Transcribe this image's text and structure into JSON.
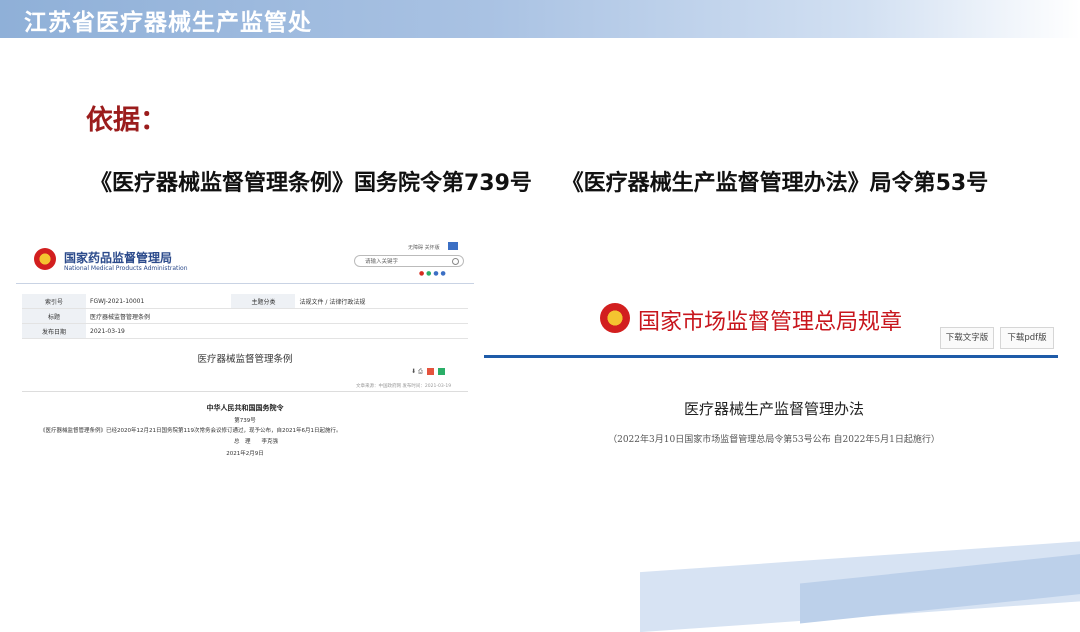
{
  "header": {
    "title": "江苏省医疗器械生产监管处"
  },
  "basis_label": "依据：",
  "regulations": [
    "《医疗器械监督管理条例》国务院令第739号",
    "《医疗器械生产监督管理办法》局令第53号"
  ],
  "nmpa": {
    "name_cn": "国家药品监督管理局",
    "name_en": "National Medical Products Administration",
    "top_links": "无障碍  关怀版",
    "search_placeholder": "请输入关键字",
    "meta": {
      "index_label": "索引号",
      "index_value": "FGWJ-2021-10001",
      "topic_label": "主题分类",
      "topic_value": "法规文件 / 法律行政法规",
      "title_label": "标题",
      "title_value": "医疗器械监督管理条例",
      "date_label": "发布日期",
      "date_value": "2021-03-19"
    },
    "doc_title": "医疗器械监督管理条例",
    "date_line": "文章来源：中国政府网 发布时间：2021-03-19",
    "issuer": "中华人民共和国国务院令",
    "order_no": "第739号",
    "promulgation": "《医疗器械监督管理条例》已经2020年12月21日国务院第119次常务会议修订通过，现予公布，自2021年6月1日起施行。",
    "premier": "总　理　　李克强",
    "sign_date": "2021年2月9日"
  },
  "samr": {
    "title": "国家市场监督管理总局规章",
    "download_text": "下载文字版",
    "download_pdf": "下载pdf版",
    "doc_title": "医疗器械生产监督管理办法",
    "doc_subtitle": "（2022年3月10日国家市场监督管理总局令第53号公布 自2022年5月1日起施行）"
  },
  "colors": {
    "accent_red": "#9b1c1c",
    "samr_red": "#c8161d",
    "nmpa_blue": "#2b4a8b",
    "line_blue": "#1e5ba8"
  }
}
